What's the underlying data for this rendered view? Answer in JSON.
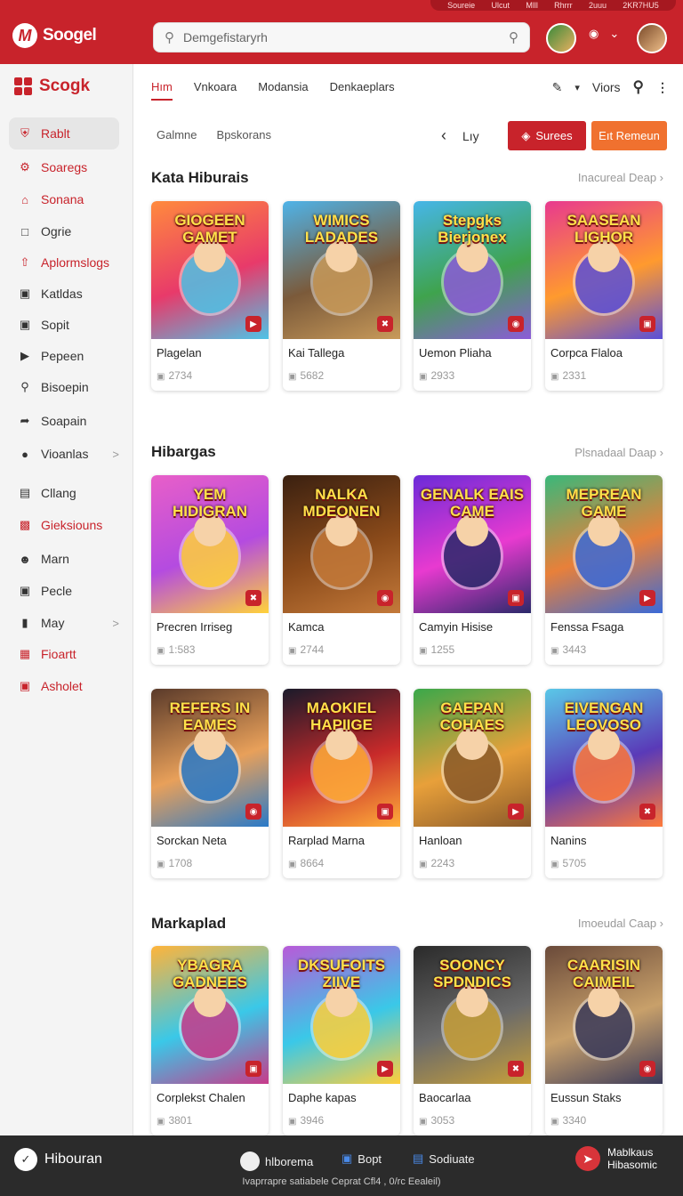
{
  "header": {
    "logo_text": "Soogel",
    "logo_badge": "M",
    "search_placeholder": "Demgefistaryrh",
    "top_strip": [
      "Soureie",
      "Ulcut",
      "Mlll",
      "Rhrrr",
      "2uuu",
      "2KR7HU5"
    ],
    "colors": {
      "brand": "#c8232b",
      "accent": "#f0712f"
    }
  },
  "sidebar": {
    "brand": "Scogk",
    "items": [
      {
        "label": "Rablt",
        "icon": "shield-icon",
        "state": "active"
      },
      {
        "label": "Soaregs",
        "icon": "gear-icon",
        "state": "red"
      },
      {
        "label": "Sonana",
        "icon": "home-icon",
        "state": "red"
      },
      {
        "label": "Ogrie",
        "icon": "square-icon",
        "state": "normal"
      },
      {
        "label": "Aplormslogs",
        "icon": "share-icon",
        "state": "red"
      },
      {
        "label": "Katldas",
        "icon": "box-icon",
        "state": "normal"
      },
      {
        "label": "Sopit",
        "icon": "bag-icon",
        "state": "normal"
      },
      {
        "label": "Pepeen",
        "icon": "play-icon",
        "state": "normal"
      },
      {
        "label": "Bisoepin",
        "icon": "search-doc-icon",
        "state": "normal"
      },
      {
        "label": "Soapain",
        "icon": "forward-icon",
        "state": "normal"
      },
      {
        "label": "Vioanlas",
        "icon": "globe-icon",
        "state": "normal",
        "chevron": ">"
      },
      {
        "label": "Cllang",
        "icon": "doc-icon",
        "state": "normal"
      },
      {
        "label": "Gieksiouns",
        "icon": "red-box-icon",
        "state": "red"
      },
      {
        "label": "Marn",
        "icon": "user-icon",
        "state": "normal"
      },
      {
        "label": "Pecle",
        "icon": "panel-icon",
        "state": "normal"
      },
      {
        "label": "May",
        "icon": "tablet-icon",
        "state": "normal",
        "chevron": ">"
      },
      {
        "label": "Fioartt",
        "icon": "calendar-icon",
        "state": "red"
      },
      {
        "label": "Asholet",
        "icon": "frame-icon",
        "state": "red"
      }
    ]
  },
  "main": {
    "tabs": [
      "Hım",
      "Vnkoara",
      "Modansia",
      "Denkaeplars"
    ],
    "tools_label": "Viors",
    "sub_tabs": [
      "Galmne",
      "Bpskorans"
    ],
    "pager_label": "Lıy",
    "button_red": "Surees",
    "button_orange": "Eıt Remeun"
  },
  "sections": [
    {
      "title": "Kata Hiburais",
      "more": "Inacureal Deap",
      "cards": [
        {
          "name": "Plagelan",
          "meta": "2734",
          "art_title": "GIOGEEN GAMET",
          "colors": [
            "#ff8a3d",
            "#e83a6a",
            "#4ec3e6"
          ]
        },
        {
          "name": "Kai Tallega",
          "meta": "5682",
          "art_title": "WIMICS LADADES",
          "colors": [
            "#4fb3e8",
            "#7b5a3a",
            "#c89a5a"
          ]
        },
        {
          "name": "Uemon Pliaha",
          "meta": "2933",
          "art_title": "Stepgks Bierjonex",
          "colors": [
            "#46b6e8",
            "#3fa34d",
            "#8c5bd8"
          ]
        },
        {
          "name": "Corpca Flaloa",
          "meta": "2331",
          "art_title": "SAASEAN LIGHOR",
          "colors": [
            "#e8398f",
            "#ff9a2e",
            "#5a4fd8"
          ]
        }
      ]
    },
    {
      "title": "Hibargas",
      "more": "Plsnadaal Daap",
      "cards": [
        {
          "name": "Precren Irriseg",
          "meta": "1:583",
          "art_title": "YEM HIDIGRAN",
          "colors": [
            "#e85fc8",
            "#b44be0",
            "#ffd23a"
          ]
        },
        {
          "name": "Kamca",
          "meta": "2744",
          "art_title": "NALKA MDEONEN",
          "colors": [
            "#3a2010",
            "#8a4a1a",
            "#c47a3a"
          ]
        },
        {
          "name": "Camyin Hisise",
          "meta": "1255",
          "art_title": "GENALK EAIS CAME",
          "colors": [
            "#6b2bd8",
            "#e83ad0",
            "#2a2a6a"
          ]
        },
        {
          "name": "Fenssa Fsaga",
          "meta": "3443",
          "art_title": "MEPREAN GAME",
          "colors": [
            "#3ab87a",
            "#e8803a",
            "#3a6ad8"
          ]
        }
      ]
    },
    {
      "title": "",
      "more": "",
      "cards": [
        {
          "name": "Sorckan Neta",
          "meta": "1708",
          "art_title": "REFERS IN EAMES",
          "colors": [
            "#5a3a2a",
            "#e8a05a",
            "#2a7ac8"
          ]
        },
        {
          "name": "Rarplad Marna",
          "meta": "8664",
          "art_title": "MAOKIEL HAPIIGE",
          "colors": [
            "#1a1a2a",
            "#c82a2a",
            "#ffae3a"
          ]
        },
        {
          "name": "Hanloan",
          "meta": "2243",
          "art_title": "GAEPAN COHAES",
          "colors": [
            "#3aa84a",
            "#e8a03a",
            "#8a5a2a"
          ]
        },
        {
          "name": "Nanins",
          "meta": "5705",
          "art_title": "EIVENGAN LEOVOSO",
          "colors": [
            "#5ac8e8",
            "#5a3ab8",
            "#ff7a3a"
          ]
        }
      ]
    },
    {
      "title": "Markaplad",
      "more": "Imoeudal Caap",
      "cards": [
        {
          "name": "Corplekst Chalen",
          "meta": "3801",
          "art_title": "YBAGRA GADNEES",
          "colors": [
            "#ffb43a",
            "#3ac8e8",
            "#c83a8a"
          ]
        },
        {
          "name": "Daphe kapas",
          "meta": "3946",
          "art_title": "DKSUFOITS ZIIVE",
          "colors": [
            "#b85ad8",
            "#3ac8e8",
            "#ffcf3a"
          ]
        },
        {
          "name": "Baocarlaa",
          "meta": "3053",
          "art_title": "SOONCY SPDNDICS",
          "colors": [
            "#2a2a2a",
            "#6a6a6a",
            "#c8a03a"
          ]
        },
        {
          "name": "Eussun Staks",
          "meta": "3340",
          "art_title": "CAARISIN CAIMEIL",
          "colors": [
            "#6a4a3a",
            "#c8a06a",
            "#3a3a5a"
          ]
        }
      ]
    }
  ],
  "bottombar": {
    "left_label": "Hibouran",
    "items": [
      "hlborema",
      "Bopt",
      "Sodiuate"
    ],
    "right_label_1": "Mablkaus",
    "right_label_2": "Hibasomic",
    "footer": "Ivaprrapre satiabele Ceprat Cfl4 , 0/rc Eealeil)"
  }
}
